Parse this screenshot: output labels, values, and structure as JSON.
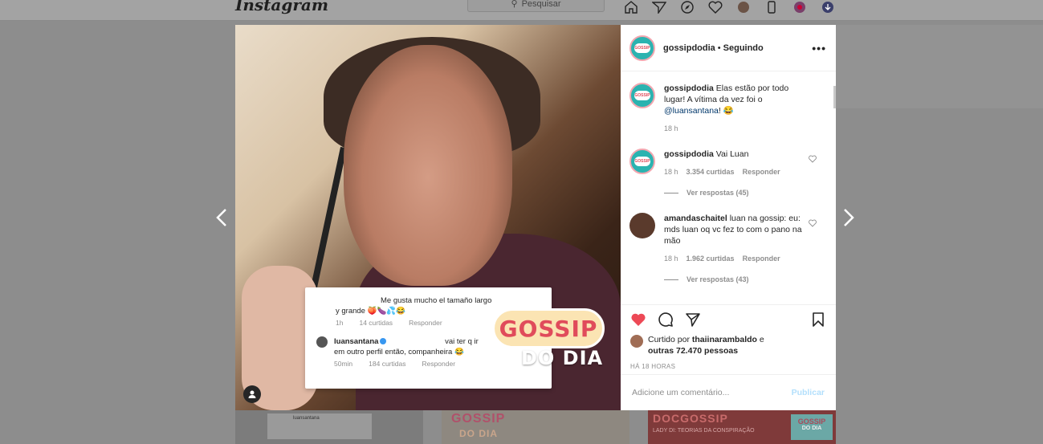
{
  "nav": {
    "logo": "Instagram",
    "search_placeholder": "Pesquisar"
  },
  "background_tiles": {
    "tile1": "luansantana",
    "tile2": "GOSSIP",
    "tile2_sub": "DO DIA",
    "tile3_title": "DOCGOSSIP",
    "tile3_sub": "LADY DI: TEORIAS DA CONSPIRAÇÃO",
    "tile3_badge": "GOSSIP",
    "tile3_badge_sub": "DO DIA"
  },
  "media": {
    "card_comment_line1": "Me gusta mucho el tamaño largo",
    "card_comment_line2": "y grande 🍑🍆💦😂",
    "card_comment_time": "1h",
    "card_comment_likes": "14 curtidas",
    "card_comment_reply": "Responder",
    "card_reply_user": "luansantana",
    "card_reply_text1": "vai ter q ir",
    "card_reply_text2": "em outro perfil então, companheira 😂",
    "card_reply_time": "50min",
    "card_reply_likes": "184 curtidas",
    "card_reply_reply": "Responder",
    "sticker_main": "GOSSIP",
    "sticker_sub": "DO DIA"
  },
  "panel": {
    "header": {
      "username": "gossipdodia",
      "separator": "•",
      "follow_status": "Seguindo",
      "avatar_text": "GOSSIP"
    },
    "caption": {
      "username": "gossipdodia",
      "text": "Elas estão por todo lugar! A vítima da vez foi o",
      "mention": "@luansantana",
      "text_end": "! 😂",
      "time": "18 h"
    },
    "comments": [
      {
        "username": "gossipdodia",
        "text": "Vai Luan",
        "time": "18 h",
        "likes": "3.354 curtidas",
        "reply": "Responder",
        "view_replies": "Ver respostas (45)"
      },
      {
        "username": "amandaschaitel",
        "text": "luan na gossip: eu: mds luan oq vc fez to com o pano na mão",
        "time": "18 h",
        "likes": "1.962 curtidas",
        "reply": "Responder",
        "view_replies": "Ver respostas (43)"
      }
    ],
    "likes": {
      "prefix": "Curtido por",
      "user": "thaiinarambaldo",
      "middle": "e",
      "others": "outras 72.470 pessoas"
    },
    "time_ago": "HÁ 18 HORAS",
    "add_comment_placeholder": "Adicione um comentário...",
    "publish_label": "Publicar"
  },
  "colors": {
    "like_red": "#ed4956",
    "link_blue": "#00376b",
    "publish_disabled": "#b2dffc",
    "overlay": "#8d8d8d"
  }
}
